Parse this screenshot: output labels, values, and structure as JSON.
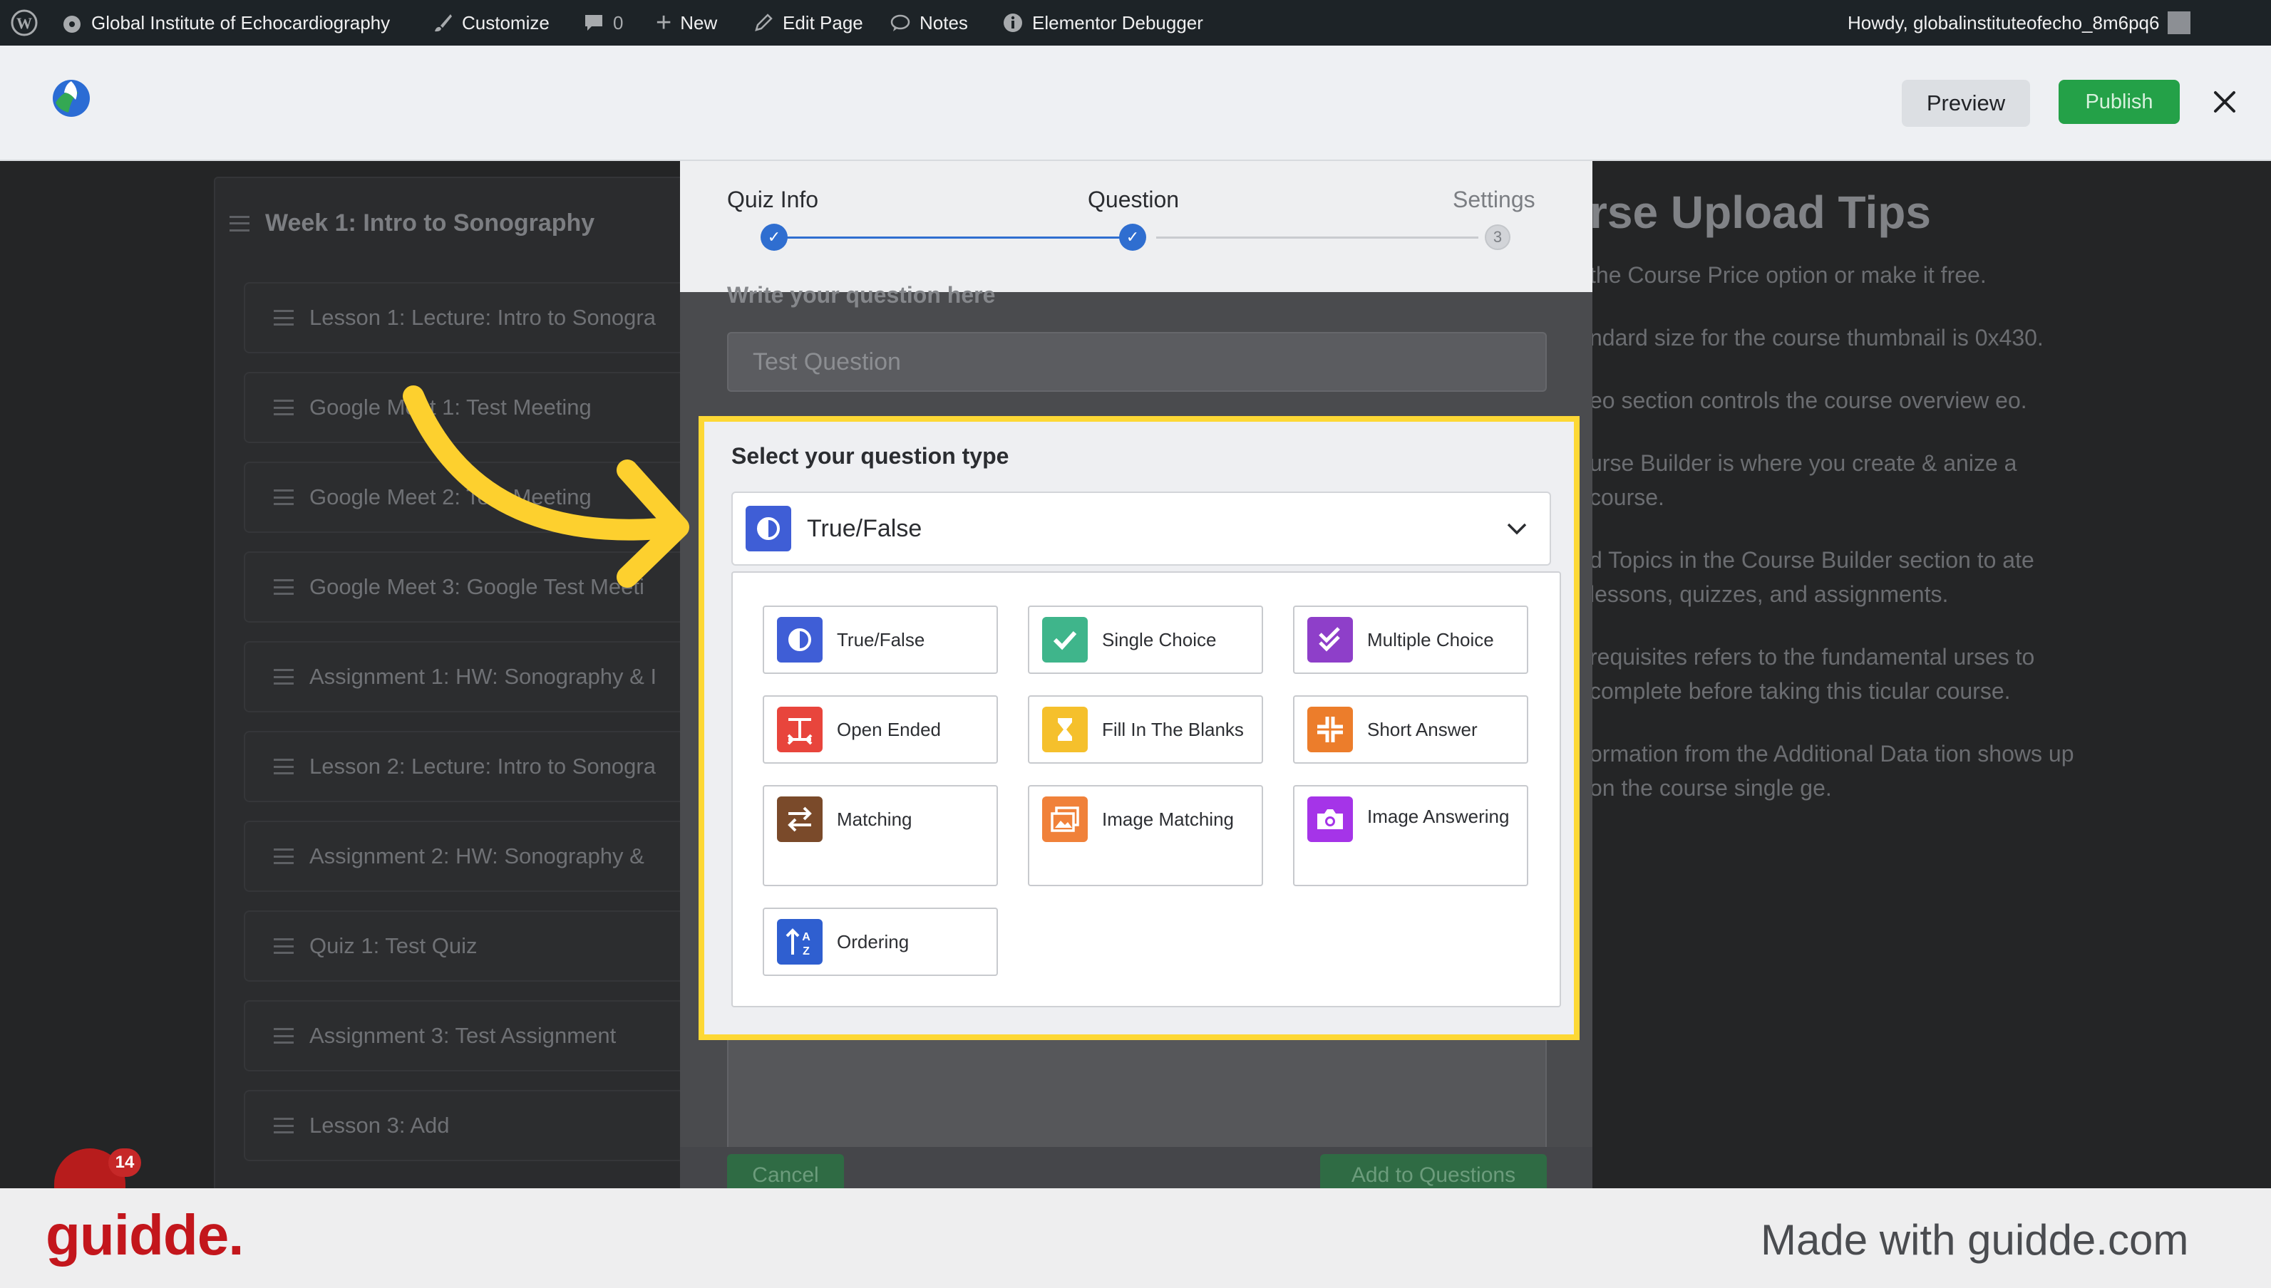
{
  "admin_bar": {
    "site_name": "Global Institute of Echocardiography",
    "customize": "Customize",
    "comments_count": "0",
    "new": "New",
    "edit_page": "Edit Page",
    "notes": "Notes",
    "debugger": "Elementor Debugger",
    "howdy": "Howdy, globalinstituteofecho_8m6pq6"
  },
  "header": {
    "preview_label": "Preview",
    "publish_label": "Publish"
  },
  "course_builder": {
    "topic_title": "Week 1: Intro to Sonography",
    "items": [
      "Lesson 1: Lecture: Intro to Sonogra",
      "Google Meet 1: Test Meeting",
      "Google Meet 2: Test Meeting",
      "Google Meet 3: Google Test Meeti",
      "Assignment 1: HW: Sonography & I",
      "Lesson 2: Lecture: Intro to Sonogra",
      "Assignment 2: HW: Sonography &",
      "Quiz 1: Test Quiz",
      "Assignment 3: Test Assignment",
      "Lesson 3: Add"
    ]
  },
  "tips": {
    "title": "rse Upload Tips",
    "items": [
      "the Course Price option or make it free.",
      "ndard size for the course thumbnail is 0x430.",
      "eo section controls the course overview eo.",
      "urse Builder is where you create & anize a course.",
      "d Topics in the Course Builder section to ate lessons, quizzes, and assignments.",
      "requisites refers to the fundamental urses to complete before taking this ticular course.",
      "ormation from the Additional Data tion shows up on the course single ge."
    ]
  },
  "quiz_modal": {
    "steps": [
      {
        "label": "Quiz Info",
        "state": "done"
      },
      {
        "label": "Question",
        "state": "current"
      },
      {
        "label": "Settings",
        "state": "pending",
        "number": "3"
      }
    ],
    "question_label": "Write your question here",
    "question_value": "Test Question",
    "type_label": "Select your question type",
    "selected_type": "True/False",
    "cancel_label": "Cancel",
    "add_label": "Add to Questions",
    "types": [
      {
        "label": "True/False",
        "color": "#3f5ed6",
        "icon": "half-circle-icon"
      },
      {
        "label": "Single Choice",
        "color": "#3fb58b",
        "icon": "check-icon"
      },
      {
        "label": "Multiple Choice",
        "color": "#8e3fc9",
        "icon": "double-check-icon"
      },
      {
        "label": "Open Ended",
        "color": "#e8453c",
        "icon": "text-resize-icon"
      },
      {
        "label": "Fill In The Blanks",
        "color": "#f5c02c",
        "icon": "hourglass-icon"
      },
      {
        "label": "Short Answer",
        "color": "#ec7d2b",
        "icon": "compress-icon"
      },
      {
        "label": "Matching",
        "color": "#7a4a2a",
        "icon": "swap-arrows-icon"
      },
      {
        "label": "Image Matching",
        "color": "#f0813a",
        "icon": "images-icon"
      },
      {
        "label": "Image Answering",
        "color": "#a534e8",
        "icon": "camera-icon"
      },
      {
        "label": "Ordering",
        "color": "#2f5fd0",
        "icon": "sort-az-icon"
      }
    ]
  },
  "footer": {
    "brand": "guidde.",
    "made_with": "Made with guidde.com",
    "notification_count": "14"
  },
  "colors": {
    "highlight": "#fdd835",
    "arrow": "#fdd02e",
    "accent_blue": "#2f6ed0",
    "publish_green": "#24a148"
  }
}
